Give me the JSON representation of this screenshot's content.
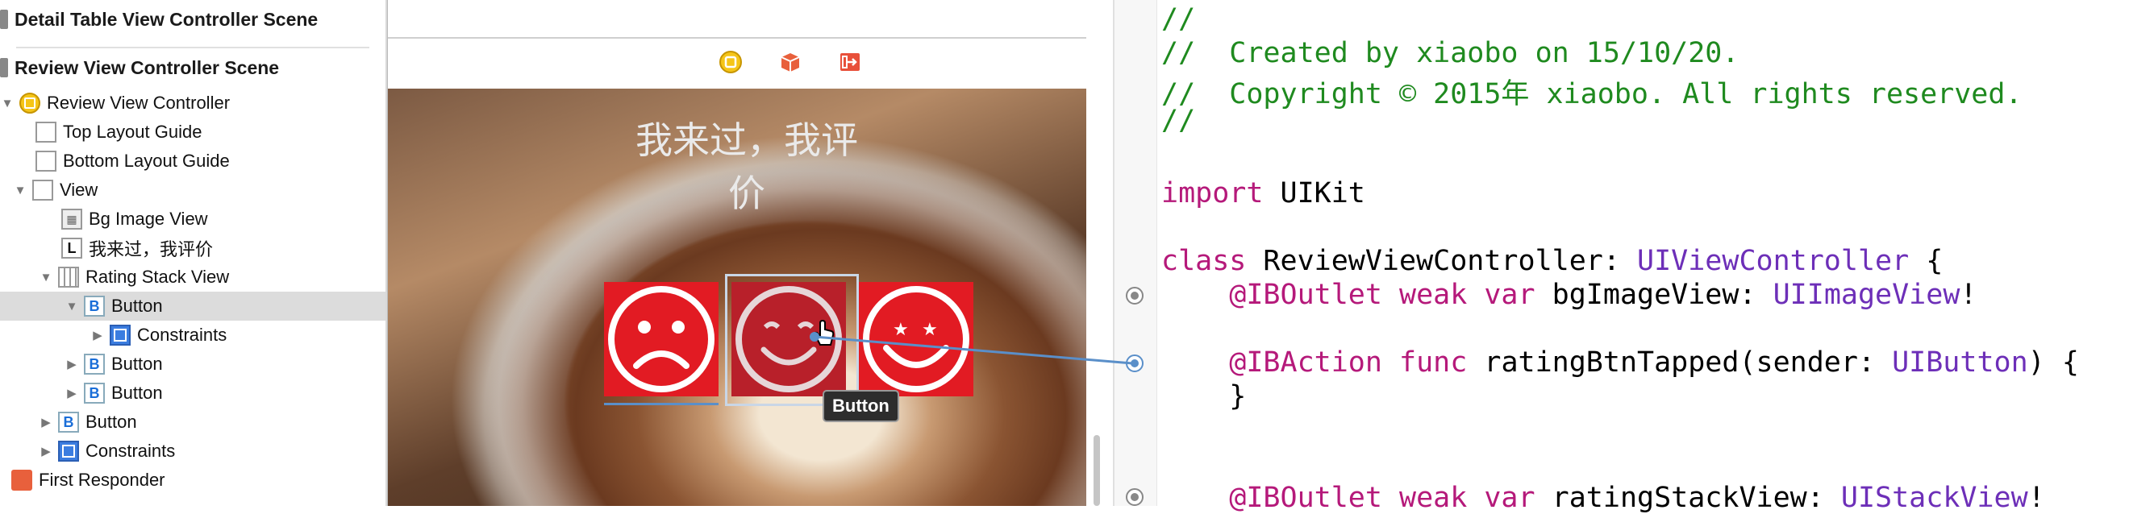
{
  "outline": {
    "scenes": [
      {
        "title": "Detail Table View Controller Scene"
      },
      {
        "title": "Review View Controller Scene"
      }
    ],
    "items": [
      {
        "label": "Review View Controller",
        "icon": "view-controller-icon"
      },
      {
        "label": "Top Layout Guide",
        "icon": "layout-guide-icon"
      },
      {
        "label": "Bottom Layout Guide",
        "icon": "layout-guide-icon"
      },
      {
        "label": "View",
        "icon": "view-icon"
      },
      {
        "label": "Bg Image View",
        "icon": "image-view-icon"
      },
      {
        "label": "我来过，我评价",
        "icon": "label-icon"
      },
      {
        "label": "Rating Stack View",
        "icon": "stack-view-icon"
      },
      {
        "label": "Button",
        "icon": "button-icon"
      },
      {
        "label": "Constraints",
        "icon": "constraints-icon"
      },
      {
        "label": "Button",
        "icon": "button-icon"
      },
      {
        "label": "Button",
        "icon": "button-icon"
      },
      {
        "label": "Button",
        "icon": "button-icon"
      },
      {
        "label": "Constraints",
        "icon": "constraints-icon"
      },
      {
        "label": "First Responder",
        "icon": "first-responder-icon"
      }
    ]
  },
  "canvas": {
    "title": "我来过，我评价",
    "tooltip": "Button",
    "toolbar_icons": [
      "view-controller-icon",
      "first-responder-icon",
      "exit-icon"
    ]
  },
  "code": {
    "lines": [
      {
        "c": "//"
      },
      {
        "c": "//  Created by xiaobo on 15/10/20."
      },
      {
        "c": "//  Copyright © 2015年 xiaobo. All rights reserved."
      },
      {
        "c": "//"
      },
      {
        "kw": "import",
        "rest": " UIKit"
      },
      {
        "kw": "class",
        "rest": " ReviewViewController: ",
        "ty": "UIViewController",
        "tail": " {"
      },
      {
        "kw": "    @IBOutlet weak var",
        "rest": " bgImageView: ",
        "ty": "UIImageView",
        "tail": "!"
      },
      {
        "kw": "    @IBAction func",
        "rest": " ratingBtnTapped(sender: ",
        "ty": "UIButton",
        "tail": ") {"
      },
      {
        "rest": "    }"
      },
      {
        "kw": "    @IBOutlet weak var",
        "rest": " ratingStackView: ",
        "ty": "UIStackView",
        "tail": "!"
      }
    ]
  },
  "colors": {
    "comment": "#1f8a1f",
    "keyword": "#b5197a",
    "type": "#6d2fb8",
    "face_red": "#e21b23"
  }
}
